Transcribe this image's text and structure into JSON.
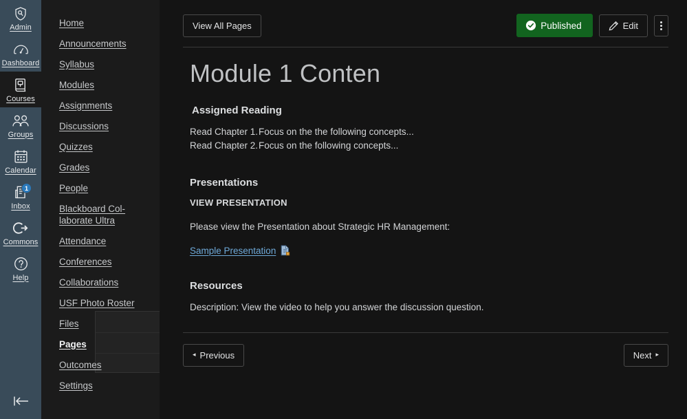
{
  "global_nav": {
    "items": [
      {
        "label": "Admin",
        "icon": "shield-admin-icon",
        "active": false
      },
      {
        "label": "Dashboard",
        "icon": "dashboard-gauge-icon",
        "active": false
      },
      {
        "label": "Courses",
        "icon": "courses-book-icon",
        "active": true
      },
      {
        "label": "Groups",
        "icon": "groups-people-icon",
        "active": false
      },
      {
        "label": "Calendar",
        "icon": "calendar-icon",
        "active": false
      },
      {
        "label": "Inbox",
        "icon": "inbox-tray-icon",
        "active": false,
        "badge": "1"
      },
      {
        "label": "Commons",
        "icon": "commons-arrow-icon",
        "active": false
      },
      {
        "label": "Help",
        "icon": "help-question-icon",
        "active": false
      }
    ],
    "collapse_label": "Collapse navigation"
  },
  "course_nav": {
    "items": [
      {
        "label": "Home",
        "active": false
      },
      {
        "label": "Announcements",
        "active": false
      },
      {
        "label": "Syllabus",
        "active": false
      },
      {
        "label": "Modules",
        "active": false
      },
      {
        "label": "Assignments",
        "active": false
      },
      {
        "label": "Discussions",
        "active": false
      },
      {
        "label": "Quizzes",
        "active": false
      },
      {
        "label": "Grades",
        "active": false
      },
      {
        "label": "People",
        "active": false
      },
      {
        "label": "Blackboard Col-laborate Ultra",
        "active": false
      },
      {
        "label": "Attendance",
        "active": false
      },
      {
        "label": "Conferences",
        "active": false
      },
      {
        "label": "Collaborations",
        "active": false
      },
      {
        "label": "USF Photo Roster",
        "active": false
      },
      {
        "label": "Files",
        "active": false
      },
      {
        "label": "Pages",
        "active": true
      },
      {
        "label": "Outcomes",
        "active": false
      },
      {
        "label": "Settings",
        "active": false
      }
    ]
  },
  "toolbar": {
    "view_all_pages_label": "View All Pages",
    "published_label": "Published",
    "published_color": "#12641F",
    "edit_label": "Edit",
    "kebab_label": "More options"
  },
  "page": {
    "title": "Module 1 Conten",
    "sections": {
      "assigned_reading": {
        "heading": "Assigned Reading",
        "rows": [
          {
            "item": "Read Chapter 1.",
            "detail": "Focus on the the following concepts..."
          },
          {
            "item": "Read Chapter 2.",
            "detail": "Focus on the following concepts..."
          }
        ]
      },
      "presentations": {
        "heading": "Presentations",
        "subheading": "VIEW PRESENTATION",
        "description": "Please view the Presentation about Strategic HR Management:",
        "link_label": "Sample Presentation",
        "link_icon": "document-file-icon"
      },
      "resources": {
        "heading": "Resources",
        "description": "Description:  View the video to help you answer the discussion question."
      }
    }
  },
  "pager": {
    "previous_label": "Previous",
    "previous_arrow": "◂",
    "next_label": "Next",
    "next_arrow": "▸"
  }
}
